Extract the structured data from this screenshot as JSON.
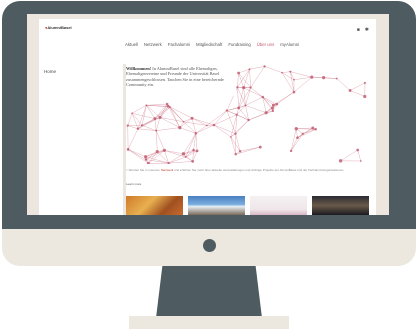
{
  "site": {
    "logo": "AlumniBasel",
    "nav": [
      {
        "label": "Aktuell"
      },
      {
        "label": "Netzwerk"
      },
      {
        "label": "Fachalumni"
      },
      {
        "label": "Mitgliedschaft"
      },
      {
        "label": "Fundraising"
      },
      {
        "label": "Über uns"
      },
      {
        "label": "myAlumni"
      }
    ],
    "active_nav": "Über uns",
    "icons": [
      "search-icon",
      "menu-icon"
    ],
    "sidebar_title": "Home",
    "intro_bold": "Willkommen!",
    "intro_text": " In AlumniBasel sind alle Ehemaligen, Ehemaligenvereine und Freunde der Universität Basel zusammengeschlossen. Tauchen Sie in eine bereichernde Community ein.",
    "caption_before": "> Werden Sie in unserem ",
    "caption_link": "Netzwerk",
    "caption_after": " und erfahren Sie mehr über aktuelle Veranstaltungen und wichtige Projekte der AlumniBasel und der Fachalumniorganisationen.",
    "learn_more": "Learn more",
    "accent_color": "#c0566c"
  }
}
